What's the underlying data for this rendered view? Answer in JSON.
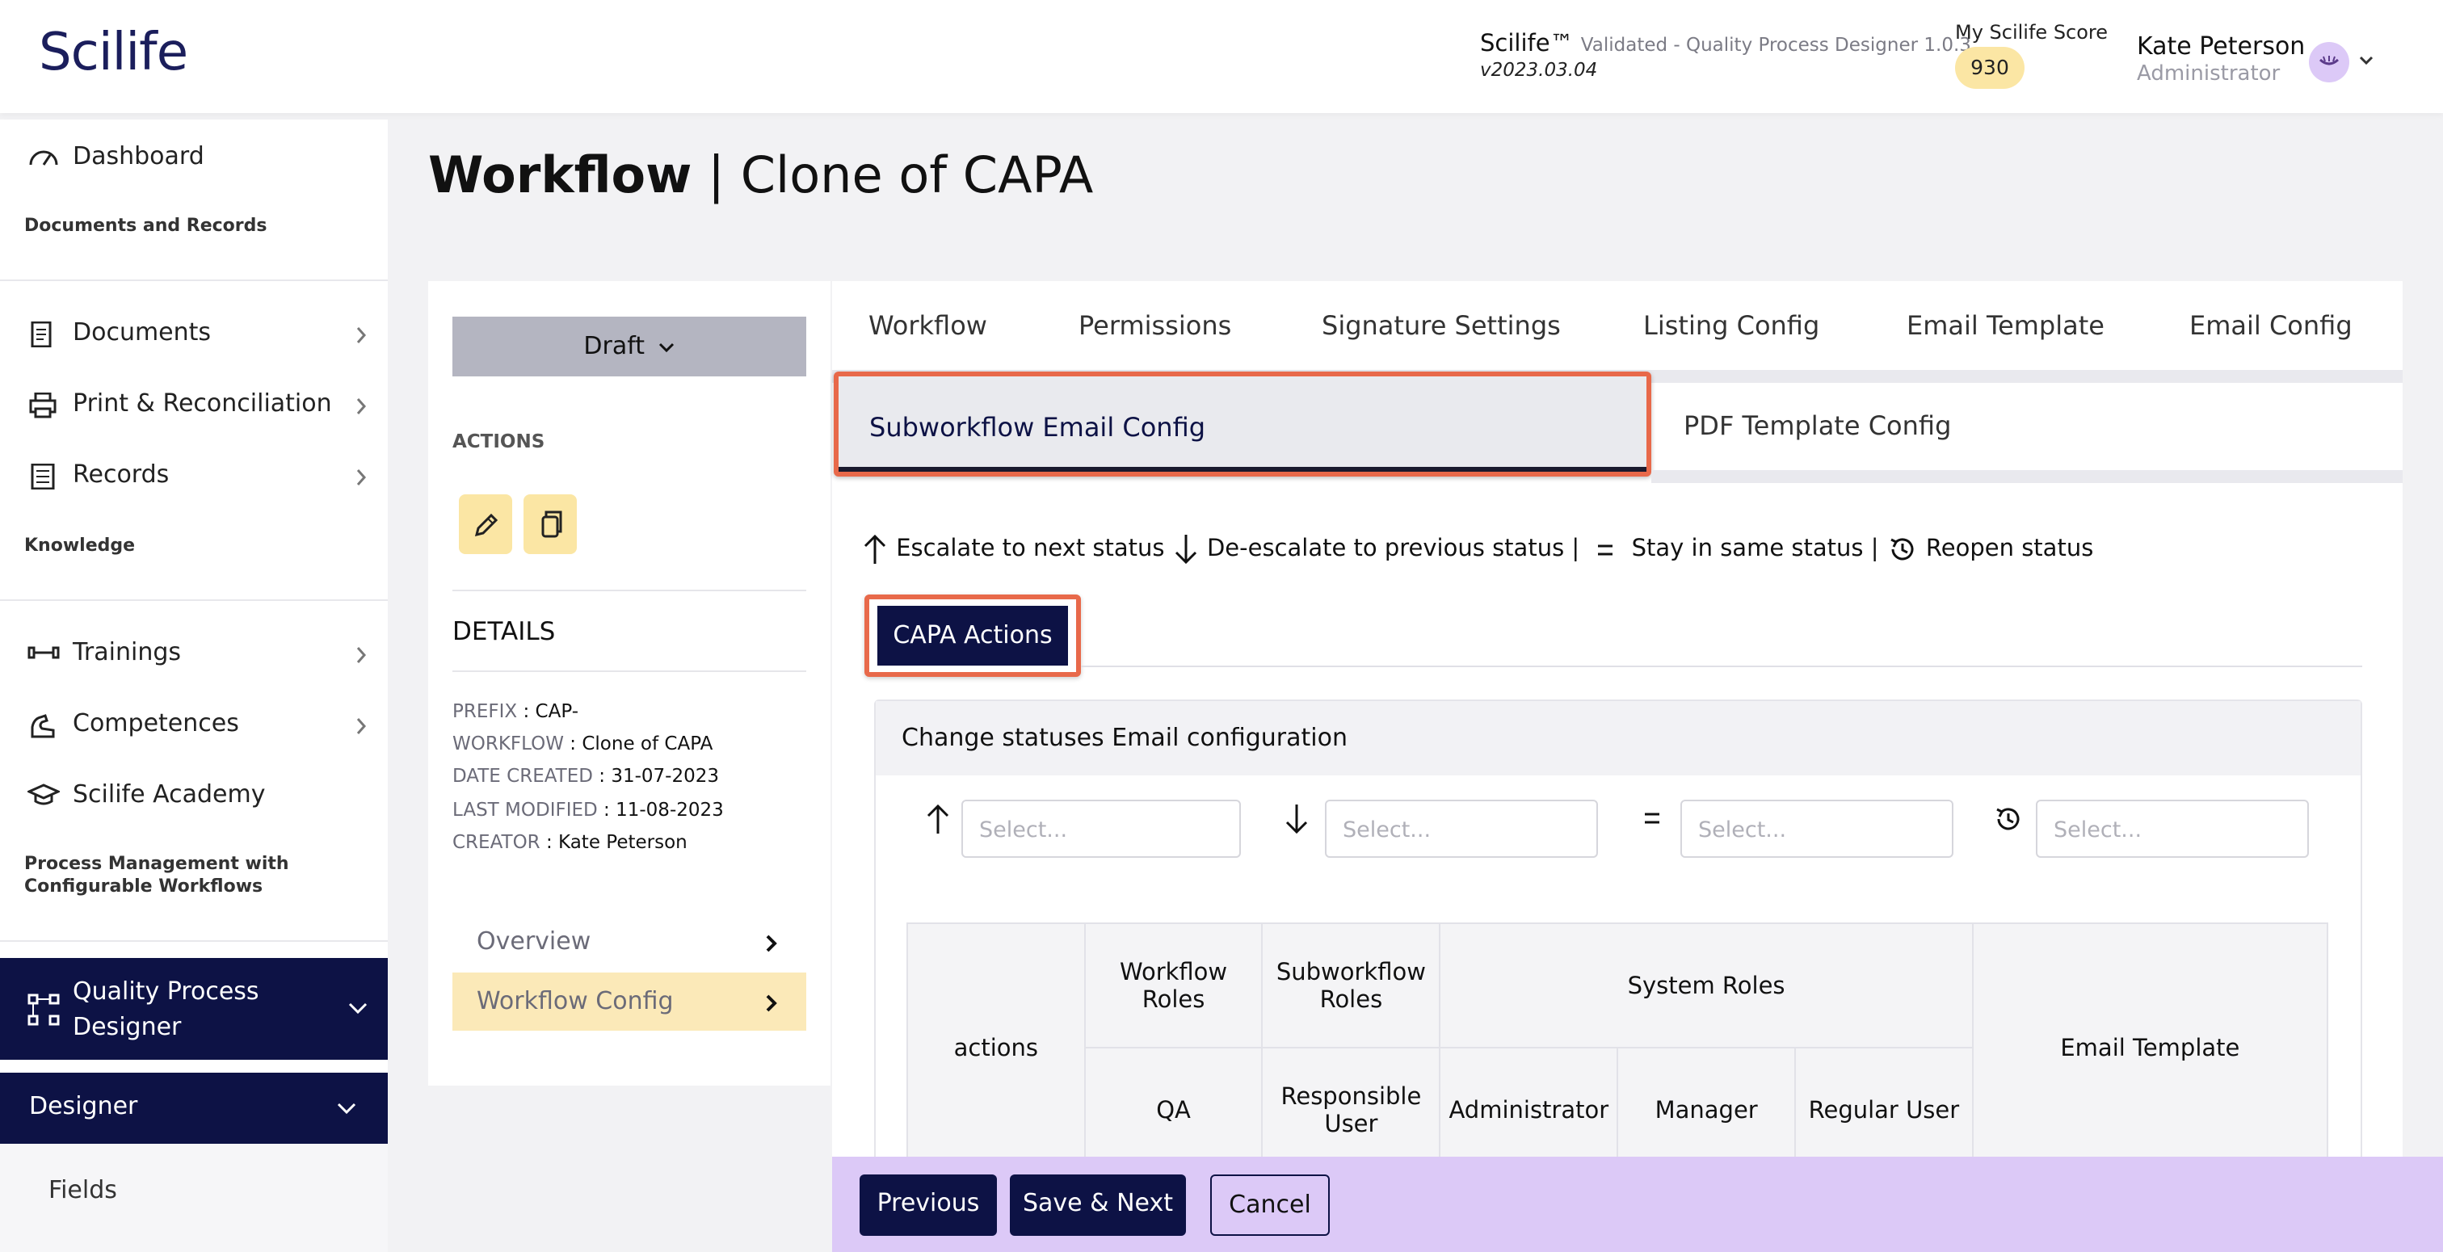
{
  "header": {
    "logo": "Scilife",
    "app_name": "Scilife™",
    "app_subtitle": "Validated - Quality Process Designer 1.0.3",
    "app_version": "v2023.03.04",
    "score_label": "My Scilife Score",
    "score_value": "930",
    "user_name": "Kate Peterson",
    "user_role": "Administrator"
  },
  "sidebar": {
    "dashboard": "Dashboard",
    "section_docs": "Documents and Records",
    "documents": "Documents",
    "print": "Print & Reconciliation",
    "records": "Records",
    "section_knowledge": "Knowledge",
    "trainings": "Trainings",
    "competences": "Competences",
    "academy": "Scilife Academy",
    "section_process_1": "Process Management with",
    "section_process_2": "Configurable Workflows",
    "qpd_line1": "Quality Process",
    "qpd_line2": "Designer",
    "designer": "Designer",
    "fields": "Fields"
  },
  "page": {
    "title_bold": "Workflow",
    "title_rest": " | Clone of CAPA"
  },
  "left_panel": {
    "status": "Draft",
    "actions_heading": "ACTIONS",
    "details_heading": "DETAILS",
    "details": [
      {
        "key": "PREFIX",
        "value": "CAP-"
      },
      {
        "key": "WORKFLOW",
        "value": "Clone of CAPA"
      },
      {
        "key": "DATE CREATED",
        "value": "31-07-2023"
      },
      {
        "key": "LAST MODIFIED",
        "value": "11-08-2023"
      },
      {
        "key": "CREATOR",
        "value": "Kate Peterson"
      }
    ],
    "nav_overview": "Overview",
    "nav_workflow_config": "Workflow Config"
  },
  "tabs": {
    "row1": [
      "Workflow",
      "Permissions",
      "Signature Settings",
      "Listing Config",
      "Email Template",
      "Email Config"
    ],
    "subworkflow_email_config": "Subworkflow Email Config",
    "pdf_template_config": "PDF Template Config"
  },
  "legend": {
    "escalate": "Escalate to next status",
    "deescalate": "De-escalate to previous status |",
    "stay": "Stay in same status |",
    "reopen": "Reopen status"
  },
  "capa_tab": "CAPA Actions",
  "config": {
    "title": "Change statuses Email configuration",
    "placeholder": "Select..."
  },
  "grid": {
    "actions": "actions",
    "workflow_roles": "Workflow Roles",
    "subworkflow_roles": "Subworkflow Roles",
    "system_roles": "System Roles",
    "email_template": "Email Template",
    "qa": "QA",
    "responsible_user": "Responsible User",
    "administrator": "Administrator",
    "manager": "Manager",
    "regular_user": "Regular User"
  },
  "footer": {
    "previous": "Previous",
    "save_next": "Save & Next",
    "cancel": "Cancel"
  },
  "colors": {
    "navy": "#0d1245",
    "highlight": "#e8694a",
    "yellow": "#fbe6a4",
    "lavender": "#dcc9f7"
  }
}
